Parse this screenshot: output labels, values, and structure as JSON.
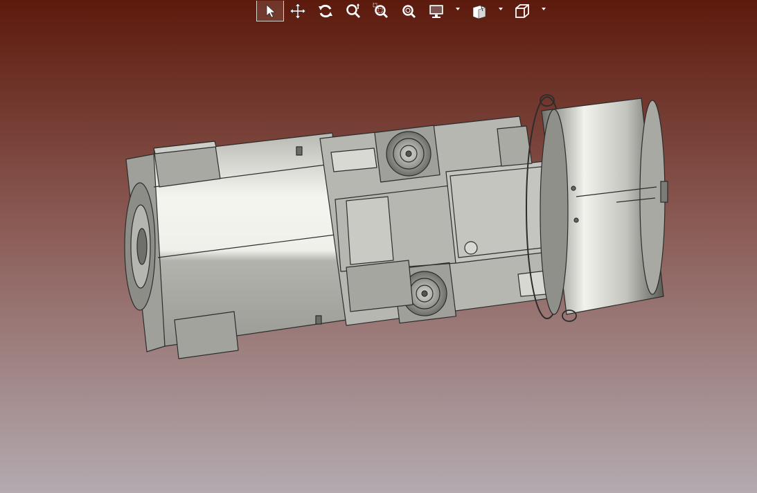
{
  "colors": {
    "background_top": "#5c1a0c",
    "background_mid": "#8a5a54",
    "background_bottom": "#b3aab0",
    "toolbar_icon": "#ffffff",
    "model_light": "#f4f4ee",
    "model_mid": "#c8c9c2",
    "model_dark": "#8d8e88",
    "model_edge": "#2c2c2c"
  },
  "toolbar": {
    "tools": [
      {
        "id": "select",
        "icon": "cursor-arrow-icon",
        "selected": true
      },
      {
        "id": "pan",
        "icon": "pan-arrows-icon",
        "selected": false
      },
      {
        "id": "rotate",
        "icon": "rotate-icon",
        "selected": false
      },
      {
        "id": "zoom",
        "icon": "zoom-icon",
        "selected": false
      },
      {
        "id": "zoom-window",
        "icon": "zoom-window-icon",
        "selected": false
      },
      {
        "id": "zoom-fit",
        "icon": "zoom-fit-icon",
        "selected": false
      },
      {
        "id": "display-mode",
        "icon": "monitor-icon",
        "dropdown": true
      },
      {
        "id": "section",
        "icon": "section-cube-icon",
        "dropdown": true
      },
      {
        "id": "view-orientation",
        "icon": "view-cube-icon",
        "dropdown": true
      }
    ]
  },
  "model": {
    "description_icon": "electric-motor-3d-model"
  }
}
